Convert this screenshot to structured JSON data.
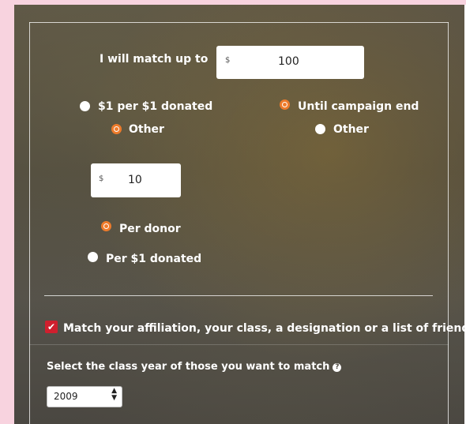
{
  "match": {
    "label": "I will match up to",
    "currency": "$",
    "amount": "100"
  },
  "ratio": {
    "option_per_dollar": "$1 per $1 donated",
    "option_other": "Other",
    "selected": "Other"
  },
  "duration": {
    "option_until_end": "Until campaign end",
    "option_other": "Other",
    "selected": "Until campaign end"
  },
  "other_amount": {
    "currency": "$",
    "value": "10"
  },
  "basis": {
    "option_per_donor": "Per donor",
    "option_per_dollar": "Per $1 donated",
    "selected": "Per donor"
  },
  "affiliation": {
    "checked": true,
    "label": "Match your affiliation, your class, a designation or a list of friends"
  },
  "class_year": {
    "label": "Select the class year of those you want to match",
    "help_icon": "question-circle-icon",
    "selected": "2009"
  },
  "colors": {
    "accent": "#ee7b2b",
    "checkbox": "#cf1f2e",
    "edge_pink": "#f8d3df"
  }
}
